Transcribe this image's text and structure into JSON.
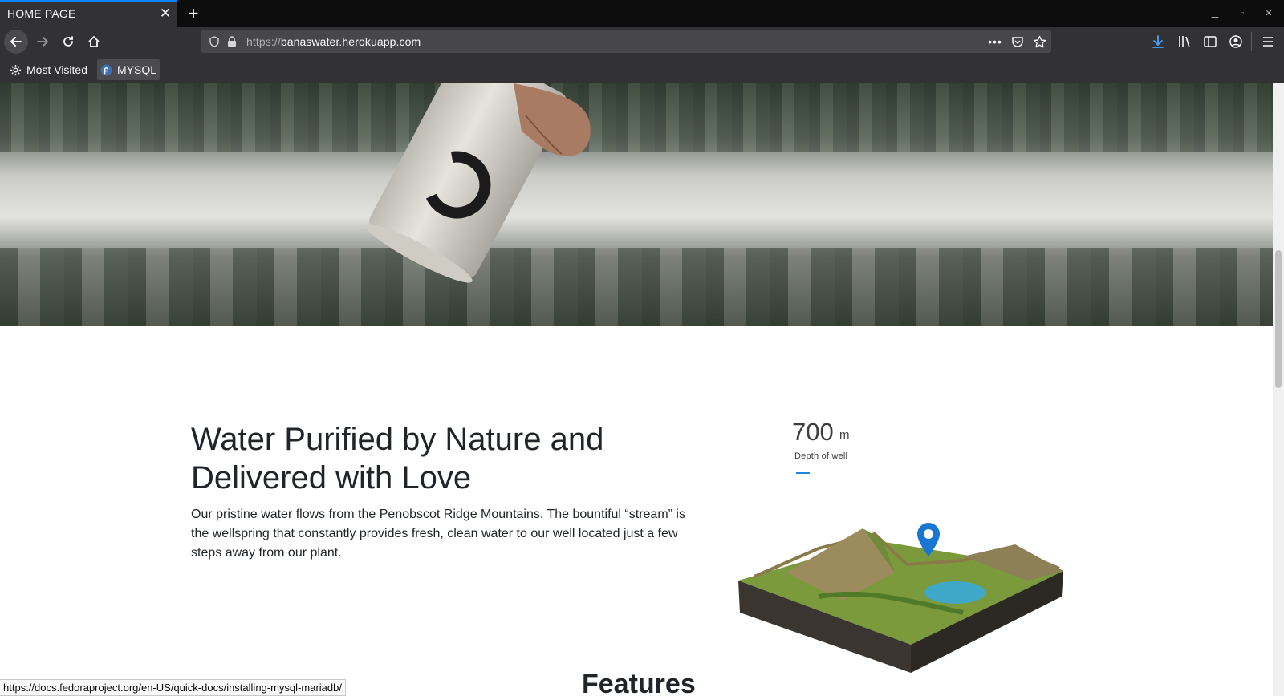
{
  "browser": {
    "tab_title": "HOME PAGE",
    "url_protocol": "https://",
    "url_host": "banaswater.herokuapp.com",
    "bookmarks": [
      {
        "label": "Most Visited",
        "icon": "gear-icon"
      },
      {
        "label": "MYSQL",
        "icon": "fedora-icon"
      }
    ],
    "status_url": "https://docs.fedoraproject.org/en-US/quick-docs/installing-mysql-mariadb/"
  },
  "section": {
    "headline": "Water Purified by Nature and Delivered with Love",
    "body": "Our pristine water flows from the Penobscot Ridge Mountains. The bountiful “stream” is the wellspring that constantly provides fresh, clean water to our well located just a few steps away from our plant.",
    "depth_value": "700",
    "depth_unit": "m",
    "depth_label": "Depth of well"
  },
  "next_section": {
    "title": "Features"
  },
  "colors": {
    "accent": "#1e88e5",
    "chrome_dark": "#0c0c0d",
    "chrome": "#323234",
    "text": "#212529"
  }
}
